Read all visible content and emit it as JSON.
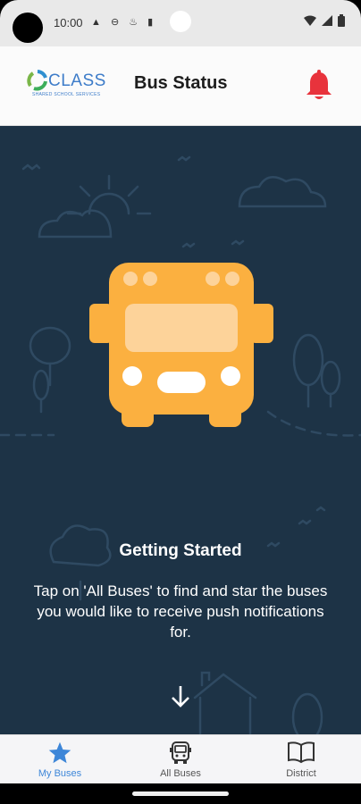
{
  "status_bar": {
    "time": "10:00"
  },
  "header": {
    "logo_text": "CLASS",
    "logo_subtitle": "SHARED SCHOOL SERVICES",
    "title": "Bus Status"
  },
  "main": {
    "heading": "Getting Started",
    "body": "Tap on 'All Buses' to find and star the buses you would like to receive push notifications for."
  },
  "tabs": [
    {
      "label": "My Buses",
      "icon": "star-icon",
      "active": true
    },
    {
      "label": "All Buses",
      "icon": "bus-icon",
      "active": false
    },
    {
      "label": "District",
      "icon": "book-icon",
      "active": false
    }
  ],
  "colors": {
    "background": "#1d3346",
    "bus": "#fbb040",
    "bell": "#e8333c",
    "active_tab": "#3d86d8"
  }
}
